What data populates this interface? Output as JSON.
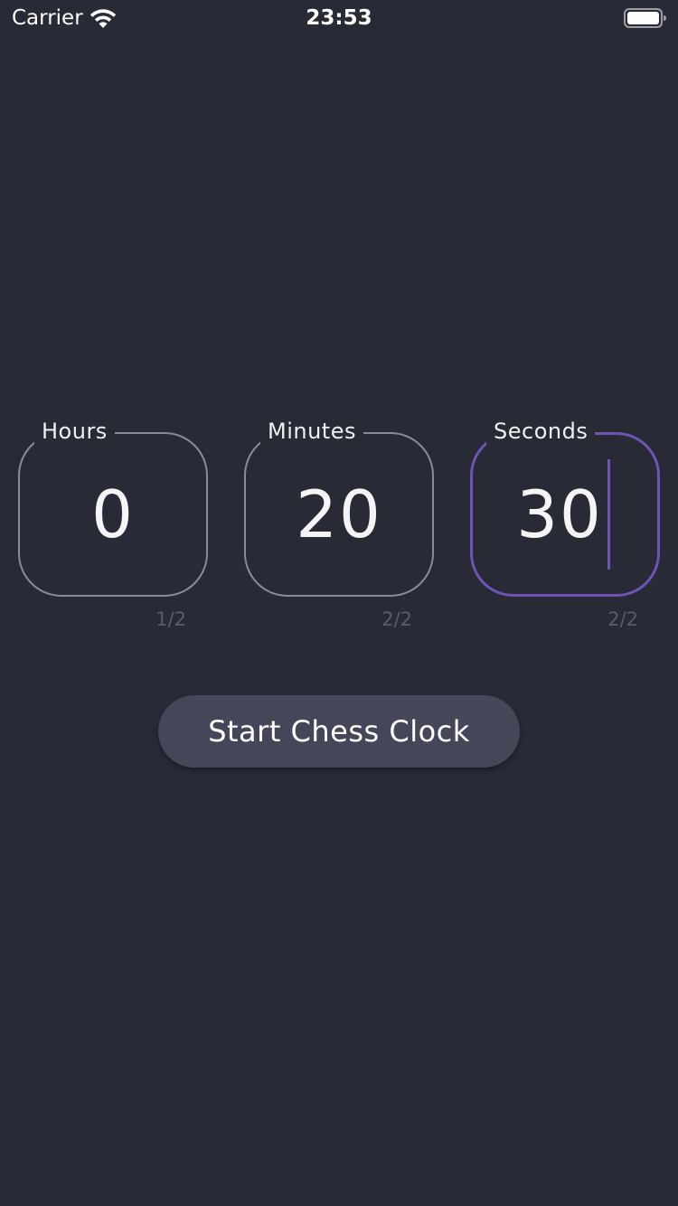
{
  "status_bar": {
    "carrier": "Carrier",
    "time": "23:53",
    "wifi_icon": "wifi-icon",
    "battery_icon": "battery-icon"
  },
  "fields": [
    {
      "label": "Hours",
      "value": "0",
      "counter": "1/2",
      "focused": false
    },
    {
      "label": "Minutes",
      "value": "20",
      "counter": "2/2",
      "focused": false
    },
    {
      "label": "Seconds",
      "value": "30",
      "counter": "2/2",
      "focused": true
    }
  ],
  "start_button": {
    "label": "Start Chess Clock"
  },
  "colors": {
    "background": "#282a36",
    "field_border": "#8a8b93",
    "focus_accent": "#6e55b4",
    "button_background": "#454759",
    "counter_text": "#5a5c66"
  }
}
